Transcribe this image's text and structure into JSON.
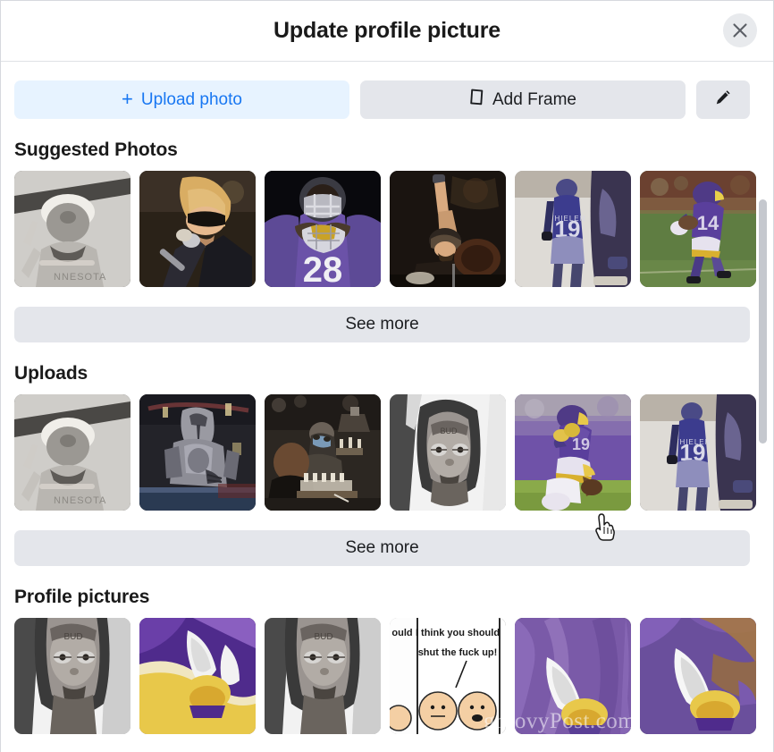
{
  "header": {
    "title": "Update profile picture",
    "close_icon": "close-icon"
  },
  "toolbar": {
    "upload_label": "Upload photo",
    "upload_plus": "+",
    "upload_icon": "plus-icon",
    "add_frame_label": "Add Frame",
    "add_frame_icon": "frame-icon",
    "edit_icon": "pencil-icon"
  },
  "colors": {
    "accent_blue": "#1877f2",
    "upload_bg": "#e7f3ff",
    "button_gray": "#e4e6eb",
    "text_primary": "#1c1e21",
    "scrollbar": "#c5c8ce"
  },
  "sections": [
    {
      "id": "suggested-photos",
      "title": "Suggested Photos",
      "see_more_label": "See more",
      "photos": [
        {
          "alt": "man-in-beanie-black-and-white",
          "palette": [
            "#d8d6d2",
            "#8d8b88",
            "#3a3937"
          ]
        },
        {
          "alt": "singer-with-sunglasses-at-microphone",
          "palette": [
            "#6a4a30",
            "#d8b070",
            "#201812"
          ]
        },
        {
          "alt": "football-player-number-28-purple-jersey",
          "palette": [
            "#0c0c10",
            "#6b4fa8",
            "#d9d9e2"
          ]
        },
        {
          "alt": "drummer-with-raised-arm-on-stage",
          "palette": [
            "#2a2018",
            "#8c6a48",
            "#110d0a"
          ]
        },
        {
          "alt": "football-player-thielen-number-19",
          "palette": [
            "#e2e0dc",
            "#3f3f8f",
            "#6f6f9e"
          ]
        },
        {
          "alt": "football-player-number-14-running",
          "palette": [
            "#5a7b3f",
            "#5b3f96",
            "#6b4a3a"
          ]
        }
      ]
    },
    {
      "id": "uploads",
      "title": "Uploads",
      "see_more_label": "See more",
      "photos": [
        {
          "alt": "man-in-beanie-black-and-white",
          "palette": [
            "#d8d6d2",
            "#8d8b88",
            "#3a3937"
          ]
        },
        {
          "alt": "mandalorian-armored-figure",
          "palette": [
            "#2b2b2f",
            "#9a9aa0",
            "#5a2a2a"
          ]
        },
        {
          "alt": "chess-player-in-mask-seated",
          "palette": [
            "#35302c",
            "#8c8278",
            "#141210"
          ]
        },
        {
          "alt": "man-in-hoodie-with-glasses-selfie",
          "palette": [
            "#e6e6e6",
            "#6f6f6f",
            "#262626"
          ]
        },
        {
          "alt": "football-player-kneeling-purple-jersey",
          "palette": [
            "#6b4fa8",
            "#8ea84f",
            "#d8b02f"
          ]
        },
        {
          "alt": "football-player-thielen-number-19",
          "palette": [
            "#e2e0dc",
            "#3f3f8f",
            "#6f6f9e"
          ]
        }
      ]
    },
    {
      "id": "profile-pictures",
      "title": "Profile pictures",
      "see_more_label": "See more",
      "photos": [
        {
          "alt": "man-in-hoodie-with-glasses-selfie",
          "palette": [
            "#e6e6e6",
            "#6f6f6f",
            "#262626"
          ]
        },
        {
          "alt": "vikings-logo-purple-and-gold",
          "palette": [
            "#4f2b8c",
            "#e8c84a",
            "#f2f2f2"
          ]
        },
        {
          "alt": "man-in-hoodie-with-glasses-selfie",
          "palette": [
            "#e6e6e6",
            "#6f6f6f",
            "#262626"
          ]
        },
        {
          "alt": "comic-strip-speech-bubble",
          "palette": [
            "#ffffff",
            "#1a1a1a",
            "#f0cba8"
          ]
        },
        {
          "alt": "vikings-horn-logo-purple",
          "palette": [
            "#7a5aa8",
            "#e8c84a",
            "#f2f2f2"
          ]
        },
        {
          "alt": "vikings-horn-logo-purple",
          "palette": [
            "#6a4f9c",
            "#e8c84a",
            "#f2f2f2"
          ]
        }
      ]
    }
  ],
  "overlay": {
    "watermark": "groovyPost.com",
    "cursor_icon": "pointing-hand-cursor"
  },
  "scrollbar": {
    "position_label": "vertical-scrollbar"
  }
}
